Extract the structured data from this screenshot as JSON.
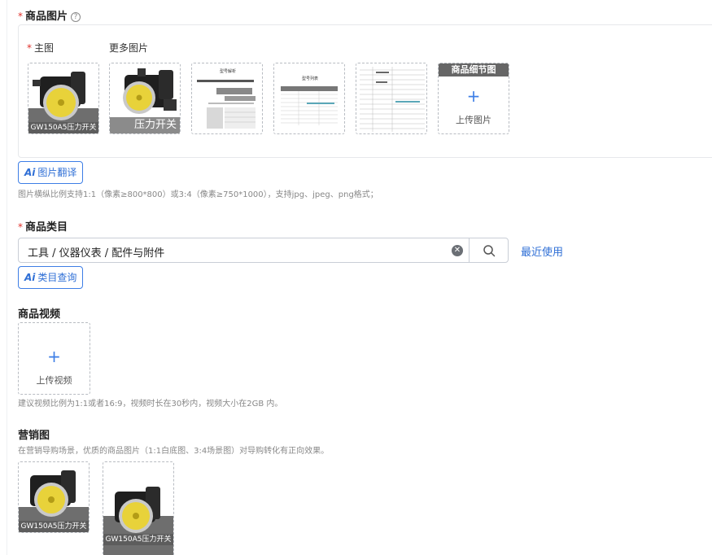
{
  "product_images": {
    "required_mark": "*",
    "title": "商品图片",
    "help_icon": "?",
    "main_label": "主图",
    "more_label": "更多图片",
    "main_image_caption": "GW150A5压力开关",
    "more_image_caption": "压力开关",
    "detail_tile_header": "商品细节图",
    "upload_plus": "+",
    "upload_label": "上传图片",
    "doc1_title": "型号解析",
    "doc2_title": "型号列表",
    "ai_button": {
      "badge": "Ai",
      "label": "图片翻译"
    },
    "hint": "图片横纵比例支持1:1（像素≥800*800）或3:4（像素≥750*1000），支持jpg、jpeg、png格式；"
  },
  "category": {
    "required_mark": "*",
    "title": "商品类目",
    "value": "工具 / 仪器仪表 / 配件与附件",
    "clear_icon": "✕",
    "recent_link": "最近使用",
    "ai_button": {
      "badge": "Ai",
      "label": "类目查询"
    }
  },
  "video": {
    "title": "商品视频",
    "upload_plus": "+",
    "upload_label": "上传视频",
    "hint": "建议视频比例为1:1或者16:9，视频时长在30秒内，视频大小在2GB 内。"
  },
  "marketing": {
    "title": "营销图",
    "hint": "在营销导购场景，优质的商品图片（1:1白底图、3:4场景图）对导购转化有正向效果。",
    "image1_caption": "GW150A5压力开关",
    "image2_caption": "GW150A5压力开关"
  },
  "colors": {
    "accent": "#3d7ee6",
    "required": "#e0312b",
    "device_yellow": "#e8d23a"
  }
}
